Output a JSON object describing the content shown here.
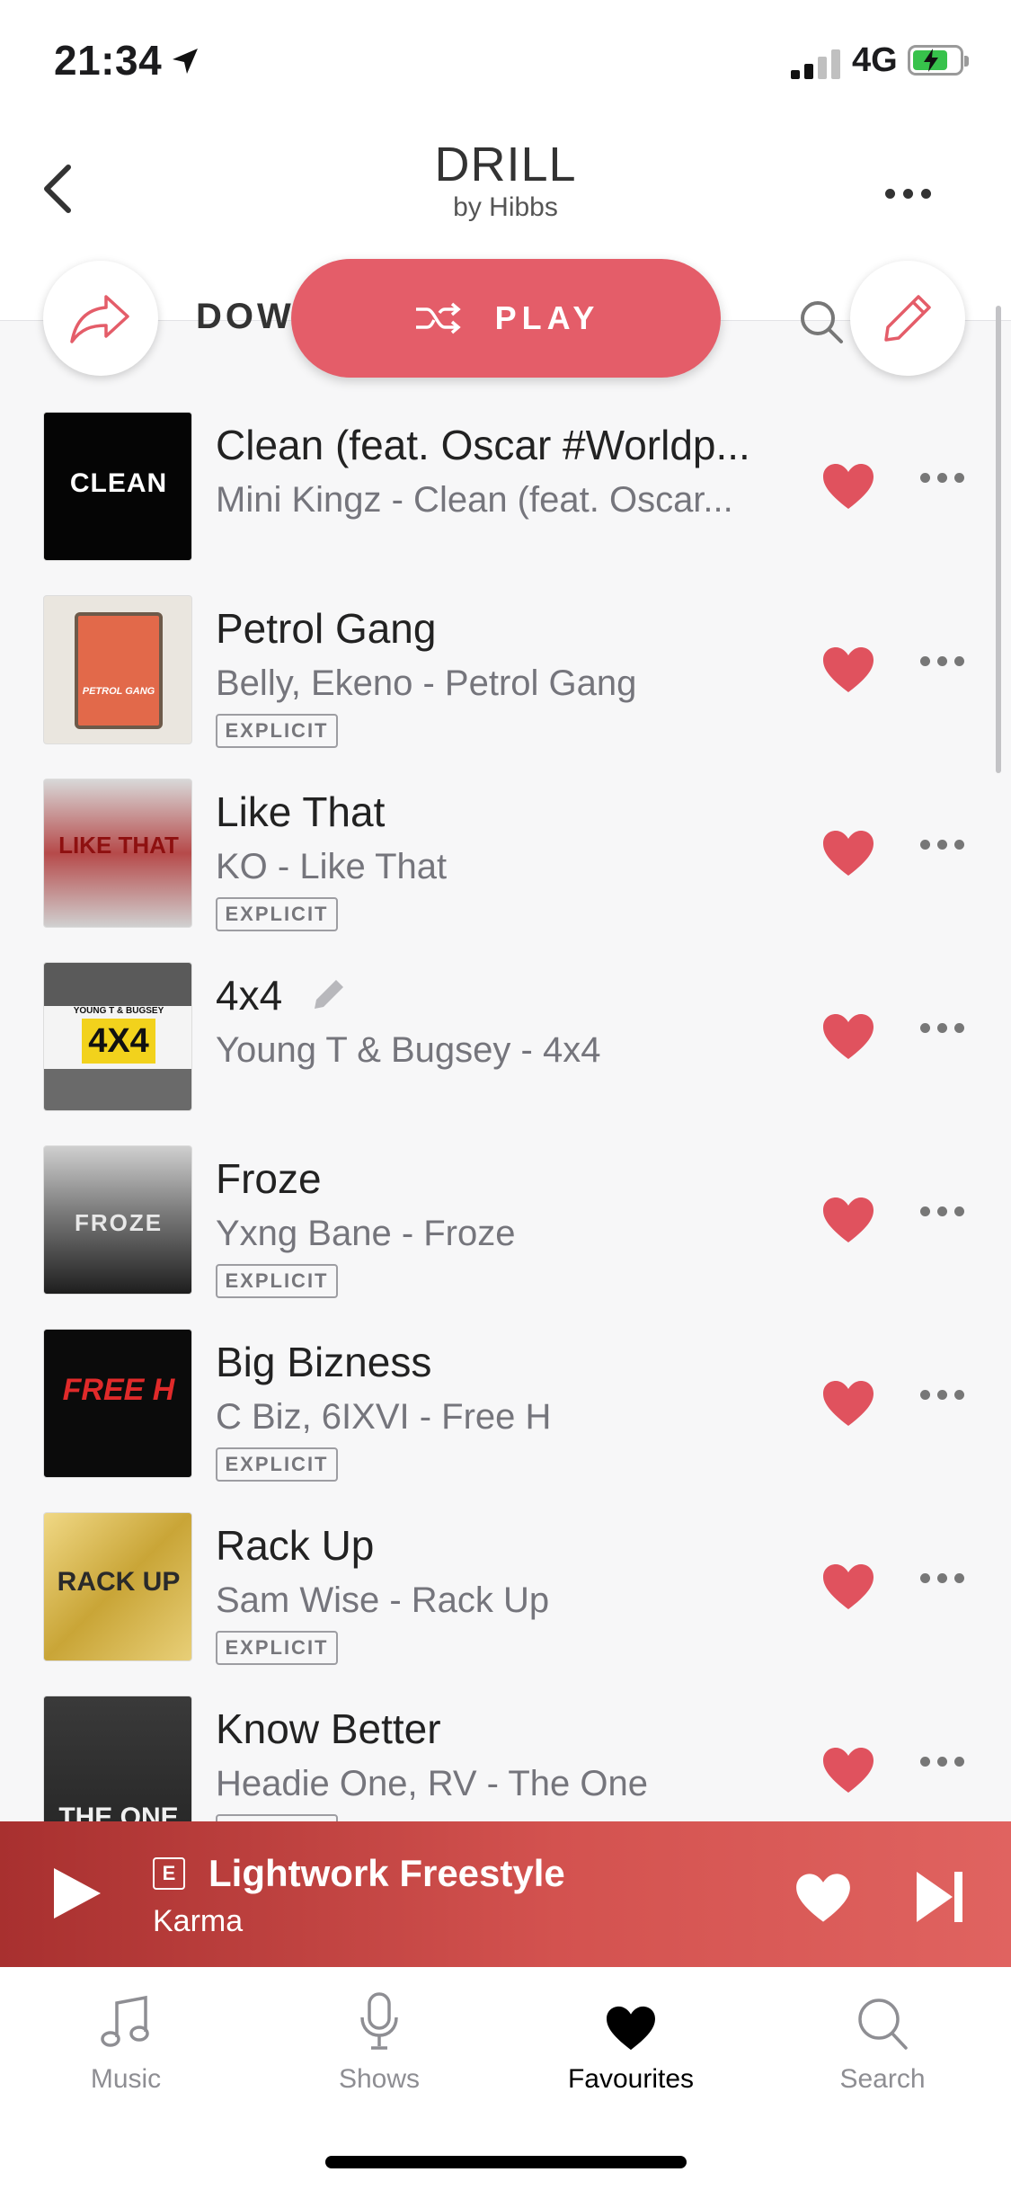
{
  "status": {
    "time": "21:34",
    "network": "4G"
  },
  "header": {
    "title": "DRILL",
    "subtitle": "by Hibbs"
  },
  "actions": {
    "play_label": "PLAY",
    "hidden_label": "DOW"
  },
  "tracks": [
    {
      "title": "Clean (feat. Oscar #Worldp...",
      "subtitle": "Mini Kingz - Clean (feat. Oscar...",
      "explicit": false,
      "art_text": "CLEAN"
    },
    {
      "title": "Petrol Gang",
      "subtitle": "Belly, Ekeno - Petrol Gang",
      "explicit": true,
      "explicit_label": "EXPLICIT",
      "art_text": "PETROL GANG"
    },
    {
      "title": "Like That",
      "subtitle": "KO - Like That",
      "explicit": true,
      "explicit_label": "EXPLICIT",
      "art_text": "LIKE THAT"
    },
    {
      "title": "4x4",
      "subtitle": "Young T & Bugsey - 4x4",
      "explicit": false,
      "art_text": "4X4",
      "art_subtext": "YOUNG T & BUGSEY"
    },
    {
      "title": "Froze",
      "subtitle": "Yxng Bane - Froze",
      "explicit": true,
      "explicit_label": "EXPLICIT",
      "art_text": "FROZE"
    },
    {
      "title": "Big Bizness",
      "subtitle": "C Biz, 6IXVI - Free H",
      "explicit": true,
      "explicit_label": "EXPLICIT",
      "art_text": "FREE H"
    },
    {
      "title": "Rack Up",
      "subtitle": "Sam Wise - Rack Up",
      "explicit": true,
      "explicit_label": "EXPLICIT",
      "art_text": "RACK UP"
    },
    {
      "title": "Know Better",
      "subtitle": "Headie One, RV - The One",
      "explicit": true,
      "explicit_label": "EXPLICIT",
      "art_text": "THE ONE"
    }
  ],
  "player": {
    "explicit_badge": "E",
    "title": "Lightwork Freestyle",
    "artist": "Karma"
  },
  "tabs": [
    {
      "label": "Music",
      "icon": "music-note-icon"
    },
    {
      "label": "Shows",
      "icon": "microphone-icon"
    },
    {
      "label": "Favourites",
      "icon": "heart-icon",
      "active": true
    },
    {
      "label": "Search",
      "icon": "search-icon"
    }
  ],
  "colors": {
    "accent": "#e45d69",
    "heart": "#e0525e",
    "player_start": "#a8302f",
    "player_end": "#e06360"
  }
}
